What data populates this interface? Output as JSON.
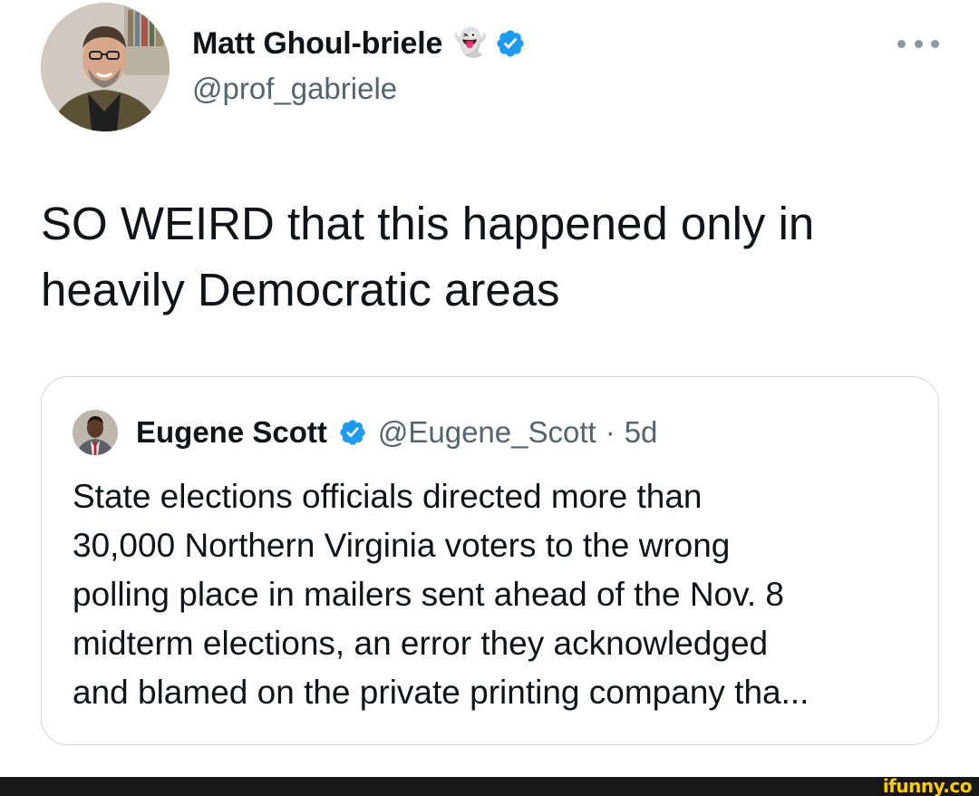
{
  "tweet": {
    "author": {
      "display_name": "Matt Ghoul-briele",
      "name_emoji": "👻",
      "handle": "@prof_gabriele",
      "avatar_icon": "avatar-man-glasses-beard",
      "verified_icon": "verified-badge-icon"
    },
    "more_icon": "more-options-icon",
    "text_lines": [
      "SO WEIRD that this happened only in",
      "heavily Democratic areas"
    ]
  },
  "quote": {
    "author": {
      "display_name": "Eugene Scott",
      "handle": "@Eugene_Scott",
      "separator": "·",
      "time": "5d",
      "avatar_icon": "avatar-man-suit",
      "verified_icon": "verified-badge-icon"
    },
    "text_lines": [
      "State elections officials directed more than",
      "30,000 Northern Virginia voters to the wrong",
      "polling place in mailers sent ahead of the Nov. 8",
      "midterm elections, an error they acknowledged",
      "and blamed on the private printing company tha..."
    ]
  },
  "watermark": {
    "text": "ifunny.co"
  },
  "colors": {
    "text_primary": "#0f1419",
    "text_secondary": "#536471",
    "verified_blue": "#1d9bf0",
    "card_border": "#cfd9de",
    "footer_bar": "#181818",
    "watermark": "#ffcc00"
  }
}
